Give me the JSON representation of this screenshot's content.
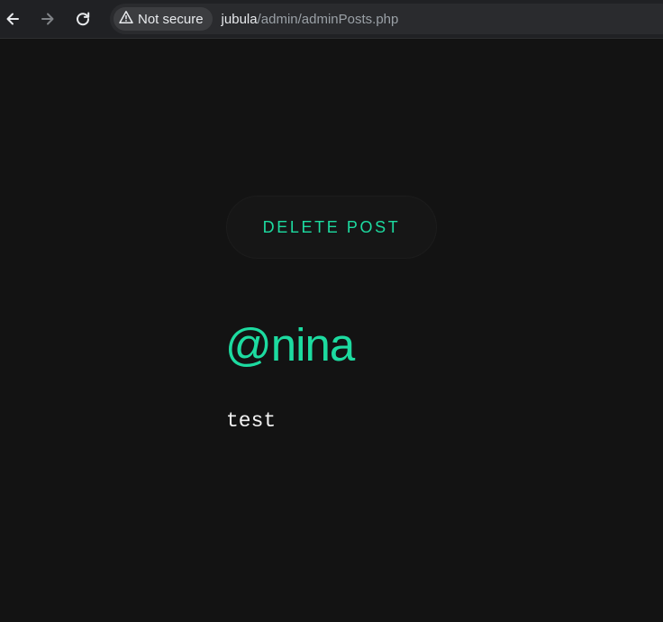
{
  "browser": {
    "back_icon": "arrow-left-icon",
    "forward_icon": "arrow-right-icon",
    "reload_icon": "reload-icon",
    "security_icon": "warning-triangle-icon",
    "security_label": "Not secure",
    "url_host": "jubula",
    "url_path": "/admin/adminPosts.php"
  },
  "page": {
    "delete_button_label": "DELETE POST",
    "author": "@nina",
    "post_text": "test"
  },
  "colors": {
    "background": "#131313",
    "accent": "#1ddba0",
    "text": "#f2f2f2"
  }
}
